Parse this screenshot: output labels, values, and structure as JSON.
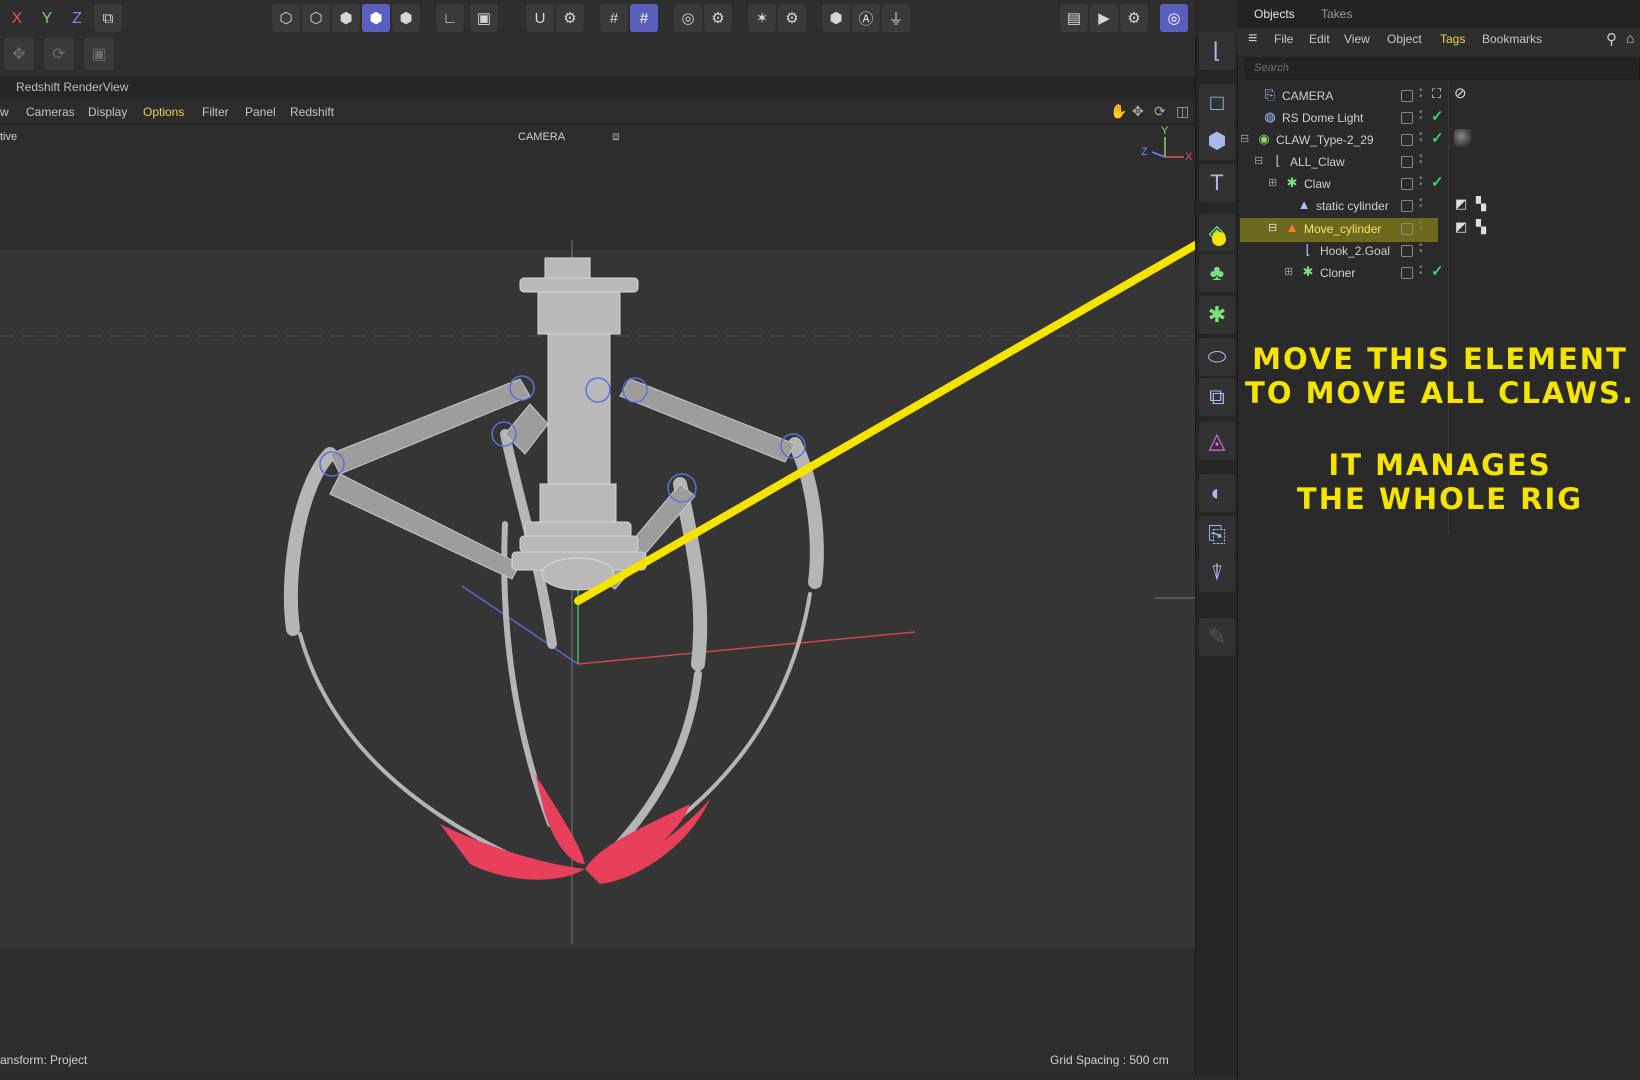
{
  "top_toolbar": {
    "axes": [
      {
        "label": "X",
        "color": "#e85050"
      },
      {
        "label": "Y",
        "color": "#7ad36a"
      },
      {
        "label": "Z",
        "color": "#6c8cff"
      }
    ],
    "buttons": [
      "coordinate-system",
      "points-mode",
      "edges-mode",
      "polygons-mode",
      "model-mode",
      "texture-mode",
      "axis-mode",
      "solo-mode",
      "snap",
      "snap-settings",
      "grid",
      "workplane",
      "render-region",
      "render-settings",
      "symmetry",
      "symmetry-settings",
      "lock",
      "auto-key",
      "plugin",
      "render-view",
      "render-picture",
      "render-settings-2",
      "redshift"
    ]
  },
  "render_view": {
    "title": "Redshift RenderView"
  },
  "viewport_menu": {
    "items": [
      "w",
      "Cameras",
      "Display",
      "Options",
      "Filter",
      "Panel",
      "Redshift"
    ],
    "highlight": "Options"
  },
  "viewport": {
    "mode_label": "tive",
    "camera_label": "CAMERA",
    "status_left": "ansform: Project",
    "status_right": "Grid Spacing : 500 cm"
  },
  "panel": {
    "tabs": [
      "Objects",
      "Takes"
    ],
    "active_tab": "Objects",
    "menu": [
      "File",
      "Edit",
      "View",
      "Object",
      "Tags",
      "Bookmarks"
    ],
    "menu_highlight": "Tags",
    "search_placeholder": "Search",
    "objects": [
      {
        "name": "CAMERA",
        "icon": "camera-icon",
        "indent": 0,
        "expander": "",
        "check": false,
        "tags": [
          "target-tag",
          "no-render-tag"
        ]
      },
      {
        "name": "RS Dome Light",
        "icon": "dome-light-icon",
        "indent": 0,
        "expander": "",
        "check": true,
        "tags": []
      },
      {
        "name": "CLAW_Type-2_29",
        "icon": "null-icon",
        "indent": 0,
        "expander": "−",
        "check": true,
        "tags": [
          "material-tag"
        ]
      },
      {
        "name": "ALL_Claw",
        "icon": "null-icon",
        "indent": 1,
        "expander": "−",
        "check": false,
        "tags": []
      },
      {
        "name": "Claw",
        "icon": "cloner-icon",
        "indent": 2,
        "expander": "+",
        "check": true,
        "tags": []
      },
      {
        "name": "static cylinder",
        "icon": "cone-icon",
        "indent": 3,
        "expander": "",
        "check": false,
        "tags": [
          "texture-tag",
          "checker-tag"
        ]
      },
      {
        "name": "Move_cylinder",
        "icon": "cone-icon-orange",
        "indent": 2,
        "expander": "−",
        "check": false,
        "tags": [
          "texture-tag",
          "checker-tag"
        ],
        "selected": true
      },
      {
        "name": "Hook_2.Goal",
        "icon": "null-icon",
        "indent": 4,
        "expander": "",
        "check": false,
        "tags": []
      },
      {
        "name": "Cloner",
        "icon": "cloner-icon",
        "indent": 3,
        "expander": "+",
        "check": true,
        "tags": []
      }
    ]
  },
  "annotation": {
    "line1": "MOVE THIS ELEMENT",
    "line2": "TO MOVE ALL CLAWS.",
    "line3": "IT MANAGES",
    "line4": "THE WHOLE RIG",
    "color": "#f5e400"
  }
}
